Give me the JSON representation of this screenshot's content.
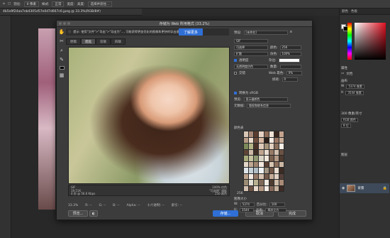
{
  "menubar": {
    "items": [
      "存储",
      "通用"
    ],
    "fields": [
      "羽化:",
      "0 像素",
      "样式:",
      "正常",
      "宽度:",
      "高度:",
      "选择并遮住..."
    ]
  },
  "doc_tab": {
    "title": "4b5e9f24aa7eb4305d57e0d7d667c6.jpeg @ 33.3%(RGB/8#)"
  },
  "dialog": {
    "title": "存储为 Web 所用格式 (33.2%)",
    "notice": "提示: 使用\"文件\">\"导出\">\"导出为\"..., 可能获得更加优化的图像和更快的导出速度。",
    "learn_more": "了解更多",
    "tabs": [
      "原稿",
      "优化",
      "双联",
      "四联"
    ],
    "active_tab": "优化",
    "info_left": [
      "GIF",
      "19.51K",
      "4 秒 @ 56.6 Kbps"
    ],
    "info_right": [
      "100% 仿色",
      "\"可选择\" 调板",
      "256 颜色"
    ],
    "status": {
      "zoom": "33.3%",
      "r": "R: --",
      "g": "G: --",
      "b": "B: --",
      "alpha": "Alpha: --",
      "hex": "十六进制: --",
      "index": "索引: --"
    },
    "buttons": {
      "preview": "预览...",
      "save": "存储...",
      "cancel": "取消",
      "done": "完成"
    },
    "settings": {
      "preset_label": "预设:",
      "preset": "[未命名]",
      "format": "GIF",
      "reduction": "可选择",
      "colors_label": "颜色:",
      "colors": "256",
      "dither_algo": "扩散",
      "dither_label": "仿色:",
      "dither": "100%",
      "transparency_label": "透明度",
      "matte_label": "杂边:",
      "trans_dither": "无透明度仿色",
      "amount_label": "数量:",
      "interlace_label": "交错",
      "web_snap_label": "Web 靠色:",
      "web_snap": "0%",
      "lossy_label": "损耗:",
      "lossy": "0",
      "convert_srgb": "转换为 sRGB",
      "preview_label": "预览:",
      "preview": "显示器颜色",
      "metadata_label": "元数据:",
      "metadata": "版权和联系信息",
      "color_table_label": "颜色表",
      "color_count": "256",
      "image_size_label": "图像大小",
      "w_label": "W:",
      "w": "5374",
      "h_label": "H:",
      "h": "3544",
      "unit": "像素",
      "percent_label": "百分比:",
      "percent": "100",
      "quality_label": "品质:",
      "quality": "两次立方",
      "animation_label": "动画"
    },
    "color_table": [
      "#d8c7b6",
      "#a88876",
      "#5b3d2f",
      "#e6d2c4",
      "#8d6a55",
      "#f0e2d6",
      "#3a2720",
      "#c4a38d",
      "#b79b84",
      "#eadbcc",
      "#6e4d3d",
      "#d4b6a0",
      "#2b1f1a",
      "#f5ebe2",
      "#9a7764",
      "#c9ad98",
      "#7d8a5a",
      "#b5b688",
      "#4a3328",
      "#dcc9b8",
      "#a5937a",
      "#e2d0c0",
      "#8a6f5c",
      "#f7efe8",
      "#5e4437",
      "#cdb9a6",
      "#3f2e26",
      "#bfa58f",
      "#e9ddd2",
      "#967a66",
      "#d1bfae",
      "#6b5244",
      "#a9aa7c",
      "#c7c3a0",
      "#8f9870",
      "#d9d4c5",
      "#efe6dc",
      "#7a5f4e",
      "#b49a86",
      "#4d3a30",
      "#e4d7ca",
      "#c0a893",
      "#9f8470",
      "#f2e8df",
      "#5a4034",
      "#d7c4b2",
      "#8b6d5a",
      "#cbb7a4",
      "#dfe5e9",
      "#c7d2d8",
      "#b1bec6",
      "#eef2f4",
      "#a29582",
      "#6f5647",
      "#e8dccf",
      "#3b2b23",
      "#bca28c",
      "#f4ece4",
      "#977b68",
      "#d6c3b1",
      "#73594a",
      "#c3ab97",
      "#e0d2c5",
      "#55403a",
      "#9c8c74",
      "#e3dfd4",
      "#b8b08f",
      "#7e6a58",
      "#f1eae2",
      "#4e3b31",
      "#cfbcaa",
      "#a88a75",
      "#d2c1b0",
      "#6a5143",
      "#e7dacd",
      "#b29783",
      "#f6eee7",
      "#85685a",
      "#c8b29f",
      "#3d2c25"
    ]
  },
  "right_panel": {
    "tabs": [
      "颜色",
      "色板"
    ],
    "color_hex": "#e01020",
    "properties_tab": "属性",
    "doc_label": "文档",
    "canvas_label": "画布",
    "w_label": "W",
    "w": "5374 像素",
    "h_label": "H",
    "h": "3544 像素",
    "resolution": "300 像素/英寸",
    "mode": "RGB 颜色",
    "bit": "8 位",
    "layers_tab": "图层",
    "layer_name": "背景"
  }
}
